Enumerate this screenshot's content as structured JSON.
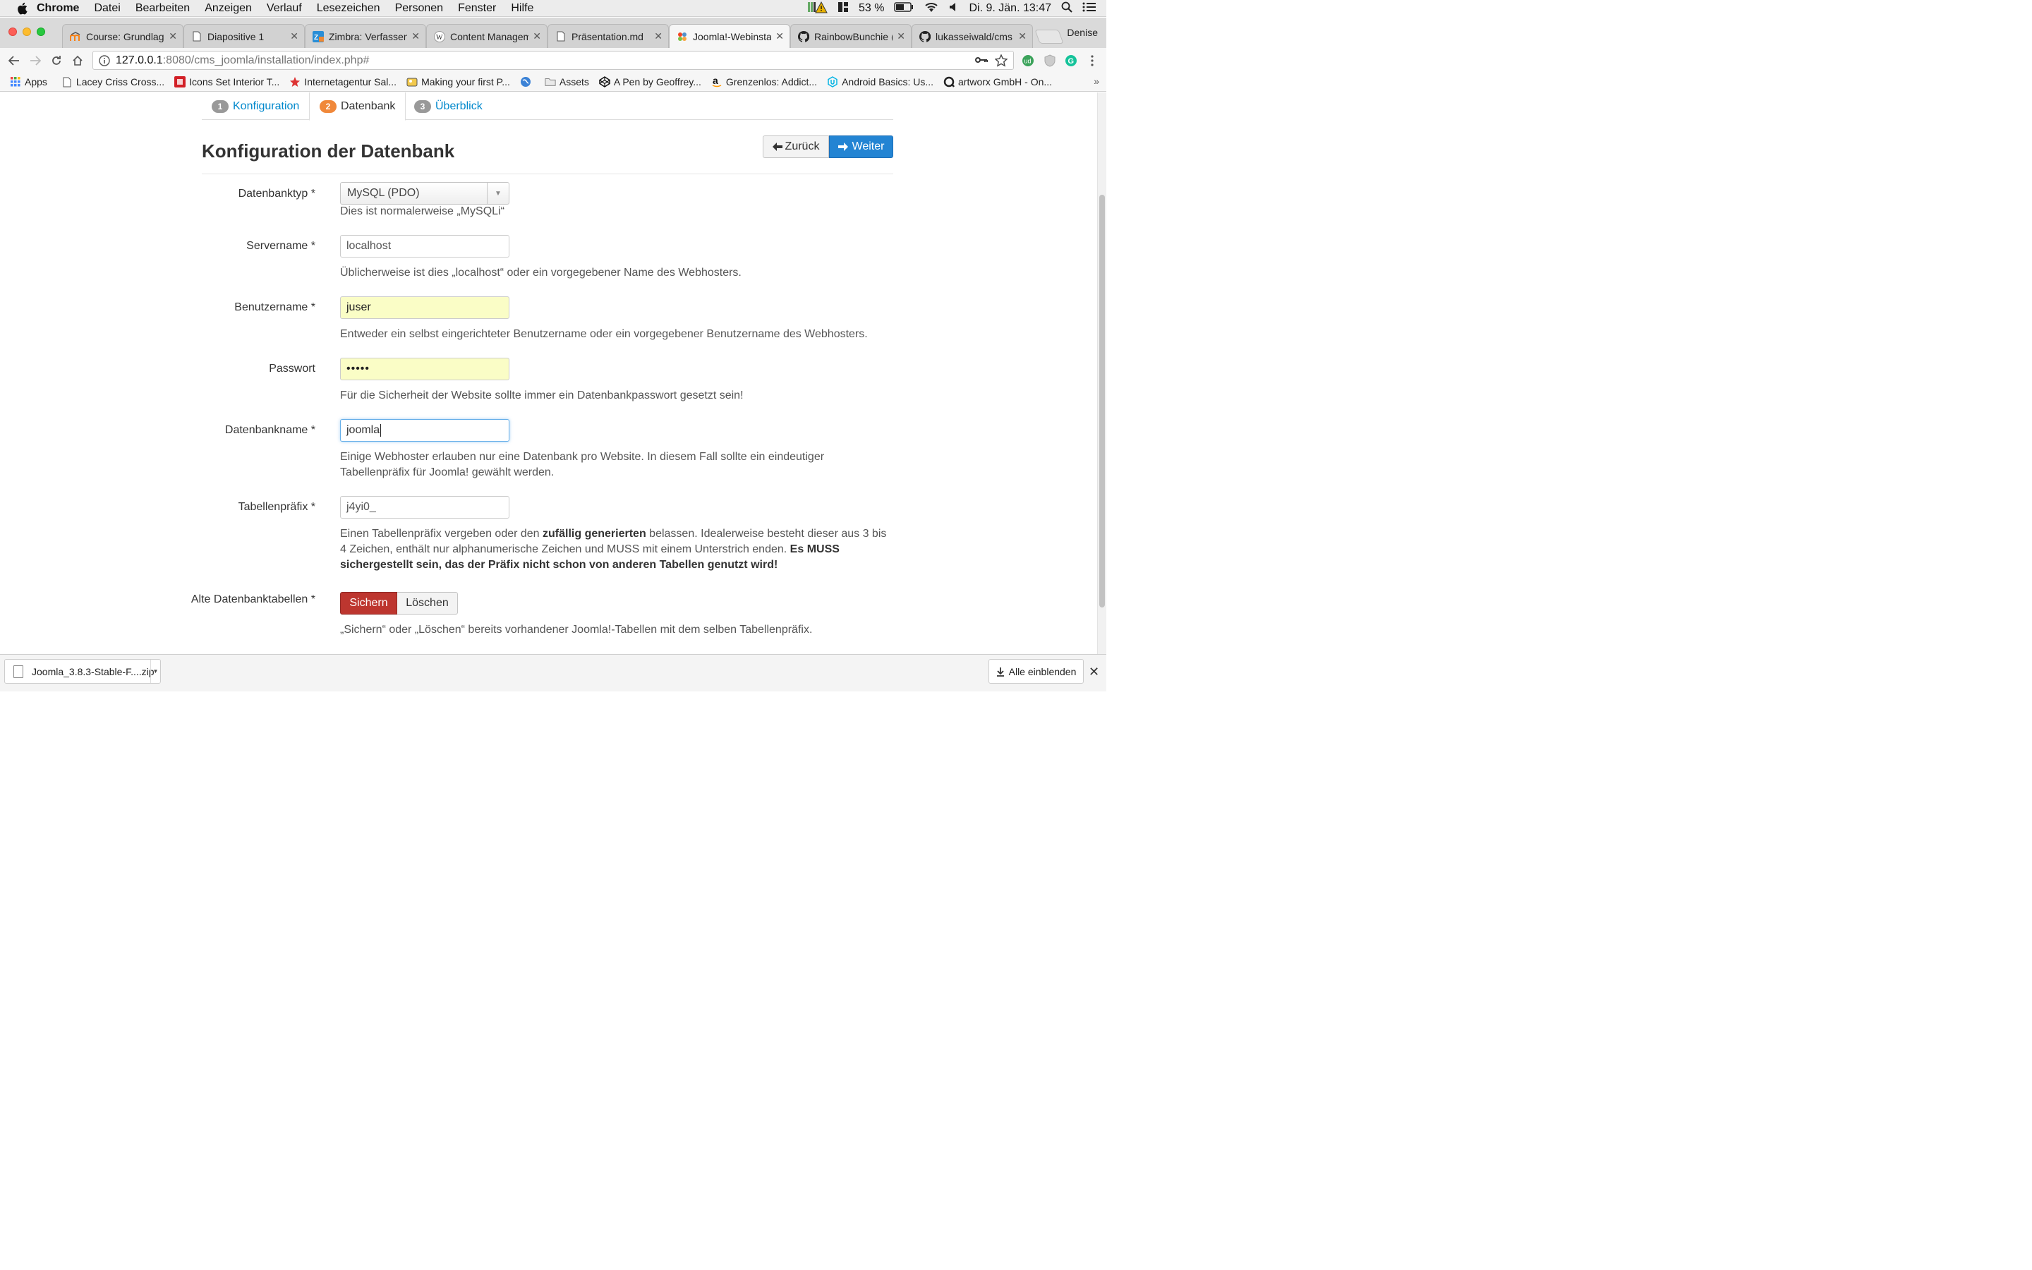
{
  "menubar": {
    "app": "Chrome",
    "items": [
      "Datei",
      "Bearbeiten",
      "Anzeigen",
      "Verlauf",
      "Lesezeichen",
      "Personen",
      "Fenster",
      "Hilfe"
    ],
    "battery": "53 %",
    "datetime": "Di. 9. Jän. 13:47"
  },
  "tabs": [
    {
      "title": "Course: Grundlage",
      "icon": "moodle-icon"
    },
    {
      "title": "Diapositive 1",
      "icon": "page-icon"
    },
    {
      "title": "Zimbra: Verfassen",
      "icon": "zimbra-icon"
    },
    {
      "title": "Content Managem",
      "icon": "wikipedia-icon"
    },
    {
      "title": "Präsentation.md",
      "icon": "page-icon"
    },
    {
      "title": "Joomla!-Webinsta",
      "icon": "joomla-icon",
      "active": true
    },
    {
      "title": "RainbowBunchie (",
      "icon": "github-icon"
    },
    {
      "title": "lukasseiwald/cms",
      "icon": "github-icon"
    }
  ],
  "profile": "Denise",
  "address": {
    "host": "127.0.0.1",
    "path": ":8080/cms_joomla/installation/index.php#"
  },
  "bookmarks": [
    {
      "label": "Apps",
      "icon": "apps-grid-icon"
    },
    {
      "label": "Lacey Criss Cross...",
      "icon": "page-icon"
    },
    {
      "label": "Icons Set Interior T...",
      "icon": "red-square-icon"
    },
    {
      "label": "Internetagentur Sal...",
      "icon": "star-icon"
    },
    {
      "label": "Making your first P...",
      "icon": "image-icon"
    },
    {
      "label": "",
      "icon": "globe-icon"
    },
    {
      "label": "Assets",
      "icon": "folder-icon"
    },
    {
      "label": "A Pen by Geoffrey...",
      "icon": "codepen-icon"
    },
    {
      "label": "Grenzenlos: Addict...",
      "icon": "amazon-icon"
    },
    {
      "label": "Android Basics: Us...",
      "icon": "udacity-icon"
    },
    {
      "label": "artworx GmbH - On...",
      "icon": "artworx-icon"
    }
  ],
  "steps": [
    {
      "num": "1",
      "label": "Konfiguration"
    },
    {
      "num": "2",
      "label": "Datenbank"
    },
    {
      "num": "3",
      "label": "Überblick"
    }
  ],
  "page": {
    "title": "Konfiguration der Datenbank",
    "back_label": "Zurück",
    "next_label": "Weiter"
  },
  "form": {
    "dbtype": {
      "label": "Datenbanktyp *",
      "value": "MySQL (PDO)",
      "help": "Dies ist normalerweise „MySQLi“"
    },
    "server": {
      "label": "Servername *",
      "value": "localhost",
      "help": "Üblicherweise ist dies „localhost“ oder ein vorgegebener Name des Webhosters."
    },
    "user": {
      "label": "Benutzername *",
      "value": "juser",
      "help": "Entweder ein selbst eingerichteter Benutzername oder ein vorgegebener Benutzername des Webhosters."
    },
    "password": {
      "label": "Passwort",
      "value": "•••••",
      "help": "Für die Sicherheit der Website sollte immer ein Datenbankpasswort gesetzt sein!"
    },
    "dbname": {
      "label": "Datenbankname *",
      "value": "joomla",
      "help": "Einige Webhoster erlauben nur eine Datenbank pro Website. In diesem Fall sollte ein eindeutiger Tabellenpräfix für Joomla! gewählt werden."
    },
    "prefix": {
      "label": "Tabellenpräfix *",
      "value": "j4yi0_",
      "help_part1": "Einen Tabellenpräfix vergeben oder den ",
      "help_bold1": "zufällig generierten",
      "help_part2": " belassen. Idealerweise besteht dieser aus 3 bis 4 Zeichen, enthält nur alphanumerische Zeichen und MUSS mit einem Unterstrich enden. ",
      "help_bold2": "Es MUSS sichergestellt sein, das der Präfix nicht schon von anderen Tabellen genutzt wird!"
    },
    "old_tables": {
      "label": "Alte Datenbanktabellen *",
      "on_label": "Sichern",
      "off_label": "Löschen",
      "help": "„Sichern“ oder „Löschen“ bereits vorhandener Joomla!-Tabellen mit dem selben Tabellenpräfix."
    }
  },
  "download": {
    "file": "Joomla_3.8.3-Stable-F....zip",
    "show_all": "Alle einblenden"
  },
  "colors": {
    "accent": "#2384d3",
    "danger": "#bd362f",
    "autofill": "#fafdc6",
    "step_active": "#f0883a",
    "step_inactive": "#999999"
  }
}
